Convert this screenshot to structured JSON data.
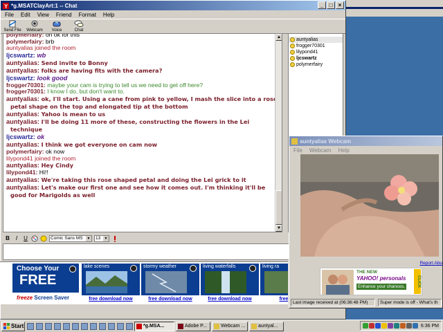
{
  "chat_window": {
    "title": "*g.MSATClayArt:1 -- Chat",
    "menu": [
      "File",
      "Edit",
      "View",
      "Friend",
      "Format",
      "Help"
    ],
    "toolbar": [
      {
        "label": "Send File",
        "icon": "send-file-icon"
      },
      {
        "label": "Webcam",
        "icon": "webcam-icon"
      },
      {
        "label": "Voice",
        "icon": "voice-icon"
      },
      {
        "label": "Chat",
        "icon": "chat-icon"
      }
    ]
  },
  "chat_log": [
    {
      "nick": "polymerfairy:",
      "text": "oh ok for this",
      "style": "cut"
    },
    {
      "nick": "polymerfairy:",
      "text": "brb",
      "style": "plain"
    },
    {
      "nick": "",
      "text": "auntyalias joined the room",
      "style": "sys"
    },
    {
      "nick": "ljcswartz:",
      "text": "wb",
      "style": "blue"
    },
    {
      "nick": "auntyalias:",
      "text": "Send invite to Bonny",
      "style": "big"
    },
    {
      "nick": "auntyalias:",
      "text": "folks are having fits with the camera?",
      "style": "big"
    },
    {
      "nick": "ljcswartz:",
      "text": "look good",
      "style": "blue"
    },
    {
      "nick": "frogger70301:",
      "text": "maybe your cam is trying to tell us we need to get off here?",
      "style": "green"
    },
    {
      "nick": "frogger70301:",
      "text": "I know I do, but don't want to.",
      "style": "green"
    },
    {
      "nick": "auntyalias:",
      "text": "ok, I'll start. Using a cane from pink to yellow, I mash the slice into a rose",
      "style": "bold"
    },
    {
      "nick": "",
      "text": "petal shape on the top and elongated tip at the bottom",
      "style": "bold-cont"
    },
    {
      "nick": "auntyalias:",
      "text": "Yahoo is mean to us",
      "style": "big"
    },
    {
      "nick": "auntyalias:",
      "text": "I'll be doing 11 more of these, constructing the flowers in the Lei",
      "style": "bold"
    },
    {
      "nick": "",
      "text": "technique",
      "style": "bold-cont"
    },
    {
      "nick": "ljcswartz:",
      "text": "ok",
      "style": "blue"
    },
    {
      "nick": "auntyalias:",
      "text": "I think we got everyone on cam now",
      "style": "big"
    },
    {
      "nick": "polymerfairy:",
      "text": "ok now",
      "style": "plain"
    },
    {
      "nick": "",
      "text": "lilypond41 joined the room",
      "style": "sys"
    },
    {
      "nick": "auntyalias:",
      "text": "Hey Cindy",
      "style": "big"
    },
    {
      "nick": "lilypond41:",
      "text": "Hi!!",
      "style": "plain"
    },
    {
      "nick": "auntyalias:",
      "text": "We're taking this rose shaped petal and doing the Lei grick to it",
      "style": "bold"
    },
    {
      "nick": "auntyalias:",
      "text": "Let's make our first one and see how it comes out. I'm thinking it'll be",
      "style": "bold"
    },
    {
      "nick": "",
      "text": "good for Marigolds as well",
      "style": "bold-cont"
    }
  ],
  "users": [
    "auntyalias",
    "frogger70301",
    "lilypond41",
    "ljcswartz",
    "polymerfairy"
  ],
  "format_bar": {
    "font": "Comic Sans MS",
    "size": "13",
    "buttons": [
      "B",
      "I",
      "U"
    ]
  },
  "ads": {
    "choose_your": "Choose Your",
    "free": "FREE",
    "brand": "freeze",
    "screen_saver": "Screen Saver",
    "tiles": [
      {
        "title": "lake scenes",
        "link": "free download now"
      },
      {
        "title": "stormy weather",
        "link": "free download now"
      },
      {
        "title": "living waterfalls",
        "link": "free download now"
      },
      {
        "title": "living ra",
        "link": "free dow"
      }
    ]
  },
  "webcam_window": {
    "title": "auntyalias Webcam",
    "menu": [
      "File",
      "Webcam",
      "Help"
    ],
    "report_abuse": "Report Abu",
    "yahoo_ad": {
      "line1": "THE NEW",
      "brand": "YAHOO! personals",
      "tagline": "Enhance your chances.",
      "click": "CLICK"
    },
    "last_image": "Last image received at (06:36:48 PM)",
    "super_mode": "Super mode is off - What's th"
  },
  "taskbar": {
    "start": "Start",
    "buttons": [
      "*g.MSA...",
      "Adobe P...",
      "Webcam ...",
      "auntyal..."
    ],
    "clock": "6:36 PM"
  }
}
